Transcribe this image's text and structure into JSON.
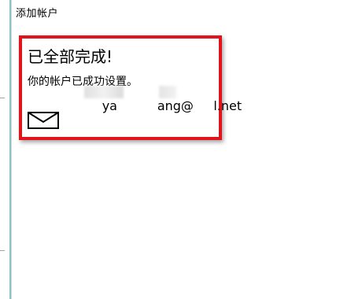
{
  "dialog": {
    "title": "添加帐户"
  },
  "card": {
    "heading": "已全部完成!",
    "subtitle": "你的帐户已成功设置。",
    "email_display": "ya          ang@     l.net",
    "icon": "envelope-icon"
  },
  "colors": {
    "highlight_border": "#e0141a",
    "background": "#ffffff",
    "text": "#000000",
    "left_accent": "#2f8f9d"
  }
}
